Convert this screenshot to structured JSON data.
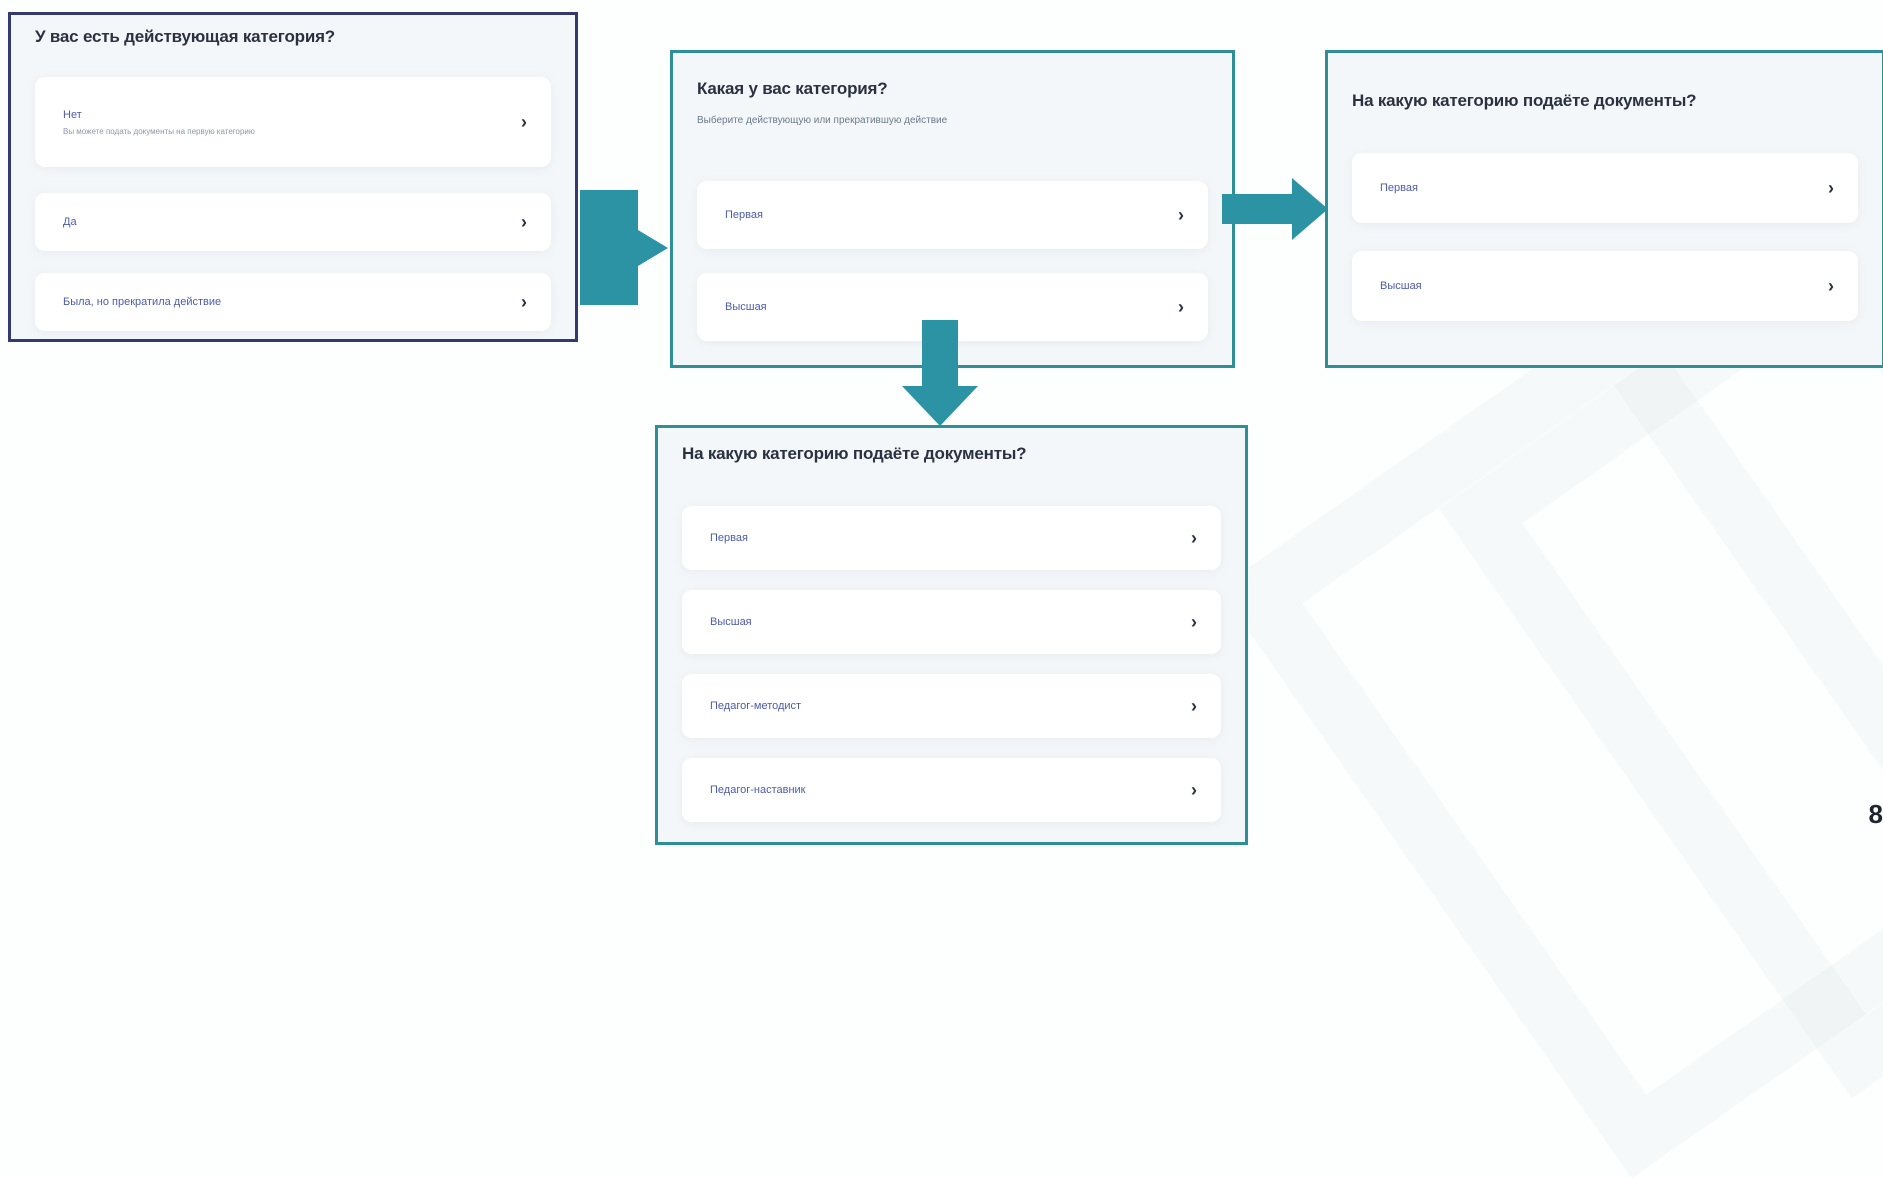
{
  "colors": {
    "teal": "#2f8f97",
    "arrow": "#2b93a4",
    "dark_border": "#34396f",
    "link": "#4c5bb0"
  },
  "card1": {
    "title": "У вас есть действующая категория?",
    "options": [
      {
        "label": "Нет",
        "description": "Вы можете подать документы на первую категорию"
      },
      {
        "label": "Да"
      },
      {
        "label": "Была, но прекратила действие"
      }
    ]
  },
  "card2": {
    "title": "Какая у вас категория?",
    "subtitle": "Выберите действующую или прекратившую действие",
    "options": [
      {
        "label": "Первая"
      },
      {
        "label": "Высшая"
      }
    ]
  },
  "card3": {
    "title": "На какую категорию подаёте документы?",
    "options": [
      {
        "label": "Первая"
      },
      {
        "label": "Высшая"
      }
    ]
  },
  "card4": {
    "title": "На какую категорию подаёте документы?",
    "options": [
      {
        "label": "Первая"
      },
      {
        "label": "Высшая"
      },
      {
        "label": "Педагог-методист"
      },
      {
        "label": "Педагог-наставник"
      }
    ]
  },
  "chevron_glyph": "›",
  "page_number": "8"
}
